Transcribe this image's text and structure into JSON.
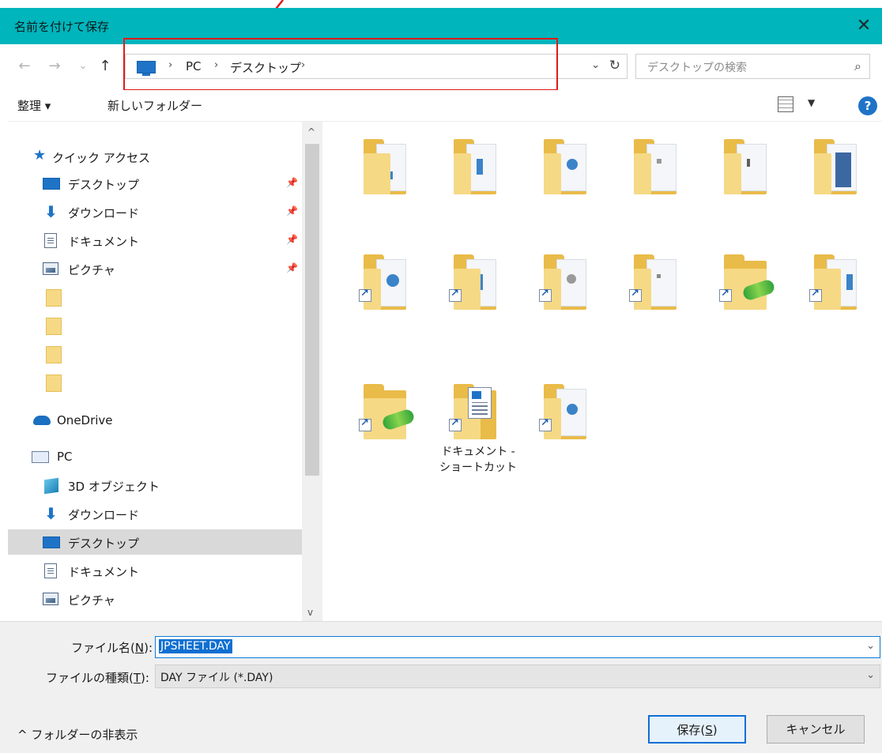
{
  "window": {
    "title": "名前を付けて保存",
    "close_glyph": "✕"
  },
  "nav": {
    "back_glyph": "←",
    "forward_glyph": "→",
    "recent_glyph": "⌄",
    "up_glyph": "↑",
    "breadcrumb": [
      "PC",
      "デスクトップ"
    ],
    "sep_glyph": "›",
    "dropdown_glyph": "⌄",
    "refresh_glyph": "↻",
    "search_placeholder": "デスクトップの検索",
    "search_glyph": "⌕"
  },
  "toolbar": {
    "organize_label": "整理 ▾",
    "new_folder_label": "新しいフォルダー",
    "view_dd_glyph": "▼",
    "help_glyph": "?"
  },
  "sidebar": {
    "pin_glyph": "📌",
    "quick_access_label": "クイック アクセス",
    "quick_items": [
      {
        "label": "デスクトップ",
        "icon": "desktop-icon"
      },
      {
        "label": "ダウンロード",
        "icon": "download-icon"
      },
      {
        "label": "ドキュメント",
        "icon": "document-icon"
      },
      {
        "label": "ピクチャ",
        "icon": "pictures-icon"
      }
    ],
    "onedrive_label": "OneDrive",
    "pc_label": "PC",
    "pc_items": [
      {
        "label": "3D オブジェクト",
        "icon": "3d-objects-icon"
      },
      {
        "label": "ダウンロード",
        "icon": "download-icon"
      },
      {
        "label": "デスクトップ",
        "icon": "desktop-icon",
        "selected": true
      },
      {
        "label": "ドキュメント",
        "icon": "document-icon"
      },
      {
        "label": "ピクチャ",
        "icon": "pictures-icon"
      }
    ],
    "scroll_up_glyph": "^",
    "scroll_down_glyph": "v"
  },
  "content": {
    "shortcut_doc_label_line1": "ドキュメント -",
    "shortcut_doc_label_line2": "ショートカット"
  },
  "bottom": {
    "filename_label": "ファイル名(",
    "filename_key": "N",
    "filename_suffix": "):",
    "filename_value": "JPSHEET.DAY",
    "filetype_label": "ファイルの種類(",
    "filetype_key": "T",
    "filetype_suffix": "):",
    "filetype_value": "DAY ファイル (*.DAY)",
    "dropdown_glyph": "⌄",
    "toggle_label": "^ フォルダーの非表示",
    "save_label": "保存(",
    "save_key": "S",
    "save_suffix": ")",
    "cancel_label": "キャンセル"
  },
  "colors": {
    "titlebar": "#00b5bc",
    "annotation_red": "#e01a1a",
    "accent_blue": "#0f6fd1",
    "folder_yellow": "#f6d985"
  }
}
